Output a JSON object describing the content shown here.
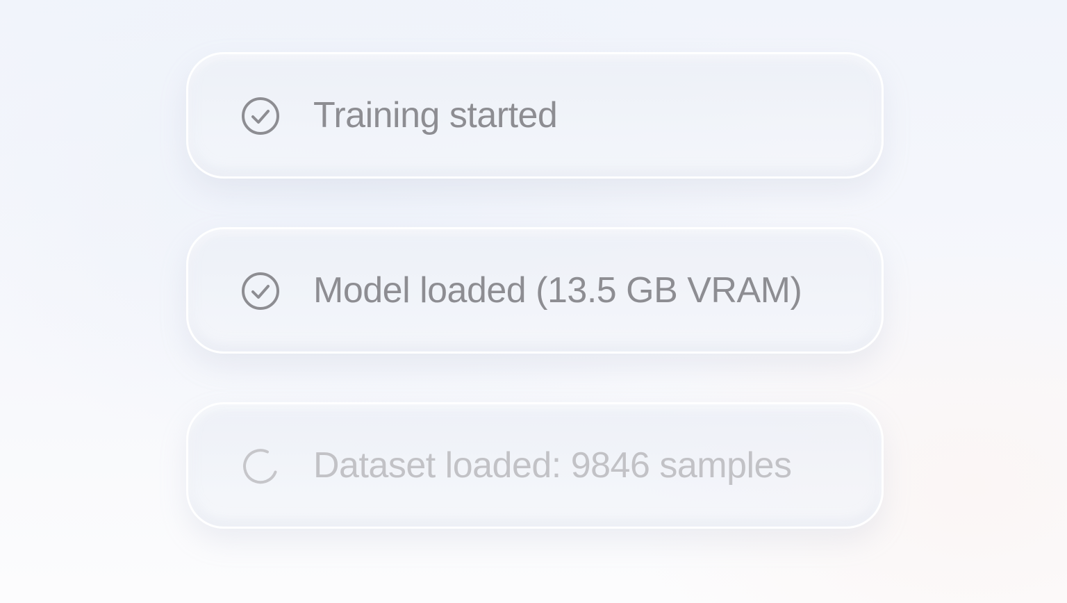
{
  "steps": [
    {
      "label": "Training started",
      "status": "done",
      "icon": "check-circle-icon"
    },
    {
      "label": "Model loaded (13.5 GB VRAM)",
      "status": "done",
      "icon": "check-circle-icon"
    },
    {
      "label": "Dataset loaded: 9846 samples",
      "status": "loading",
      "icon": "spinner-icon"
    }
  ],
  "colors": {
    "done_text": "#8d8d92",
    "pending_text": "#c2c2c6",
    "done_icon": "#8d8d92",
    "pending_icon": "#c6c6ca"
  }
}
